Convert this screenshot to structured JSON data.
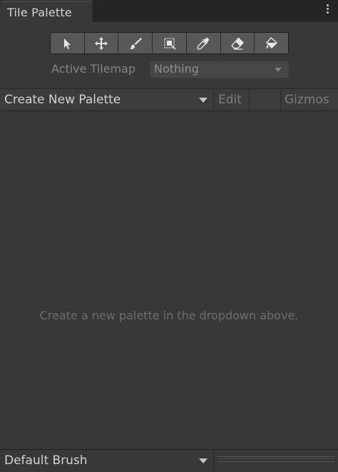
{
  "window": {
    "tab_title": "Tile Palette"
  },
  "toolbar": {
    "tools": [
      {
        "icon": "select-arrow-icon"
      },
      {
        "icon": "move-icon"
      },
      {
        "icon": "paintbrush-icon"
      },
      {
        "icon": "box-fill-icon"
      },
      {
        "icon": "eyedropper-icon"
      },
      {
        "icon": "eraser-icon"
      },
      {
        "icon": "paint-bucket-icon"
      }
    ]
  },
  "active_tilemap": {
    "label": "Active Tilemap",
    "value": "Nothing"
  },
  "palette_bar": {
    "dropdown_value": "Create New Palette",
    "edit_label": "Edit",
    "gizmos_label": "Gizmos"
  },
  "palette_area": {
    "empty_message": "Create a new palette in the dropdown above."
  },
  "brush_bar": {
    "dropdown_value": "Default Brush"
  },
  "colors": {
    "window_bg": "#383838",
    "tab_bar_bg": "#252525",
    "tool_button_bg": "#585858",
    "text_primary": "#d2d2d2",
    "text_muted": "#7d7d7d"
  }
}
